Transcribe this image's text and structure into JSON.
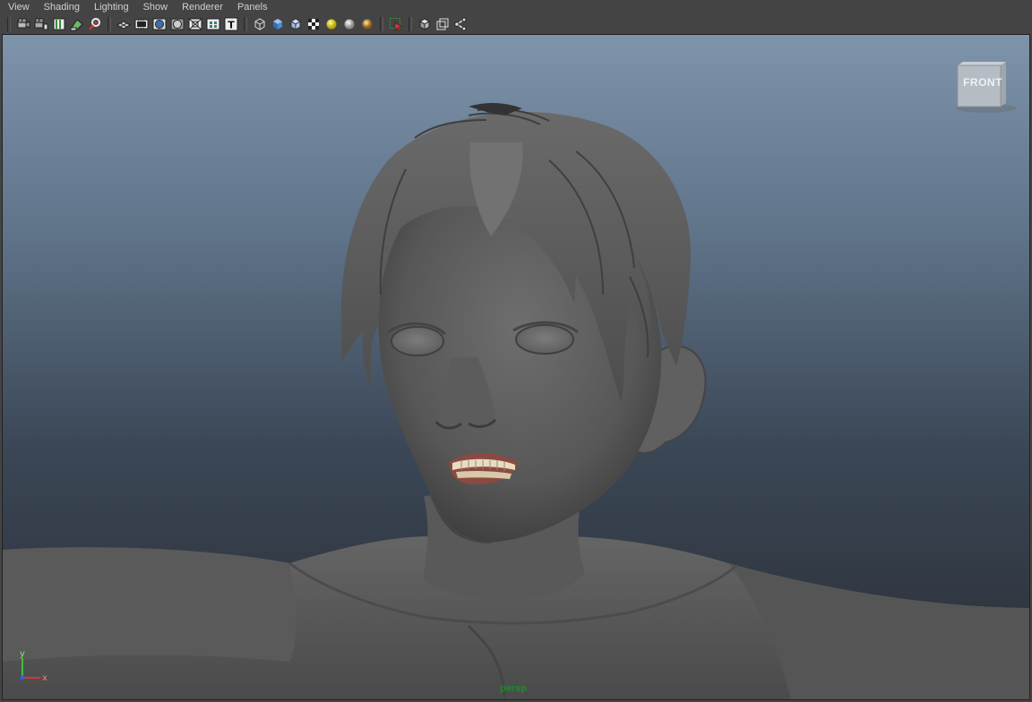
{
  "menus": [
    "View",
    "Shading",
    "Lighting",
    "Show",
    "Renderer",
    "Panels"
  ],
  "toolbar": {
    "groups": [
      [
        "select-camera-icon",
        "camera-attributes-icon",
        "bookmarks-icon",
        "image-plane-icon",
        "2d-pan-zoom-icon"
      ],
      [
        "grid-icon",
        "film-gate-icon",
        "resolution-gate-icon",
        "gate-mask-icon",
        "field-chart-icon",
        "safe-action-icon",
        "safe-title-icon"
      ],
      [
        "wireframe-icon",
        "smooth-shade-icon",
        "wireframe-on-shaded-icon",
        "textured-icon",
        "use-all-lights-icon",
        "shadows-icon",
        "high-quality-icon"
      ],
      [
        "isolate-select-icon"
      ],
      [
        "xray-icon",
        "xray-active-icon",
        "xray-joints-icon"
      ]
    ]
  },
  "viewport": {
    "camera": "persp",
    "viewcube_face": "FRONT",
    "axis_x": "x",
    "axis_y": "y"
  }
}
